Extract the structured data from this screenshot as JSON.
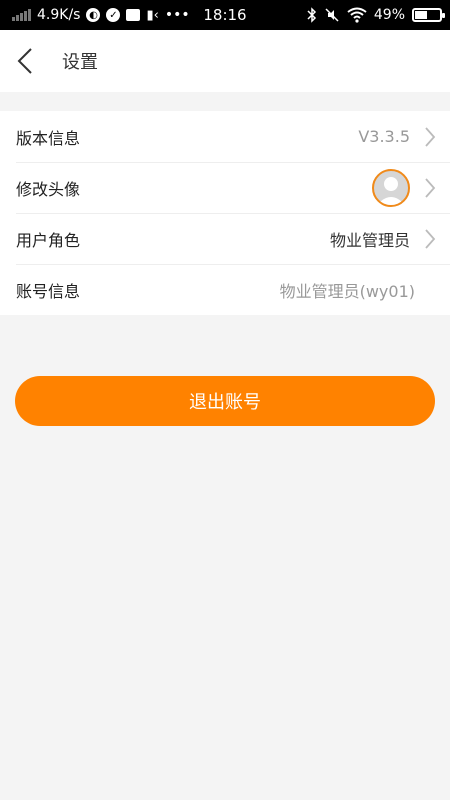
{
  "status_bar": {
    "net_speed": "4.9K/s",
    "time": "18:16",
    "battery_percent": "49%",
    "battery_level": 0.49
  },
  "header": {
    "title": "设置"
  },
  "settings": {
    "version_label": "版本信息",
    "version_value": "V3.3.5",
    "avatar_label": "修改头像",
    "role_label": "用户角色",
    "role_value": "物业管理员",
    "account_label": "账号信息",
    "account_value": "物业管理员(wy01)"
  },
  "logout_label": "退出账号",
  "colors": {
    "accent": "#ff8200",
    "avatar_border": "#f08a1a",
    "background": "#f4f4f4"
  }
}
